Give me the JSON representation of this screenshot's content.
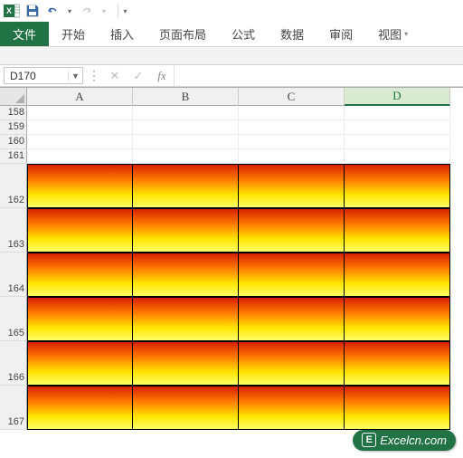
{
  "qat": {
    "undo_tip": "撤消",
    "redo_tip": "恢复"
  },
  "tabs": {
    "file": "文件",
    "home": "开始",
    "insert": "插入",
    "layout": "页面布局",
    "formula": "公式",
    "data": "数据",
    "review": "审阅",
    "view": "视图"
  },
  "namebox": {
    "value": "D170"
  },
  "fx_label": "fx",
  "columns": [
    "A",
    "B",
    "C",
    "D"
  ],
  "selected_column": "D",
  "rows_small": [
    158,
    159,
    160,
    161
  ],
  "rows_grad": [
    162,
    163,
    164,
    165,
    166,
    167
  ],
  "watermark": {
    "icon": "E",
    "text": "Excelcn.com"
  }
}
